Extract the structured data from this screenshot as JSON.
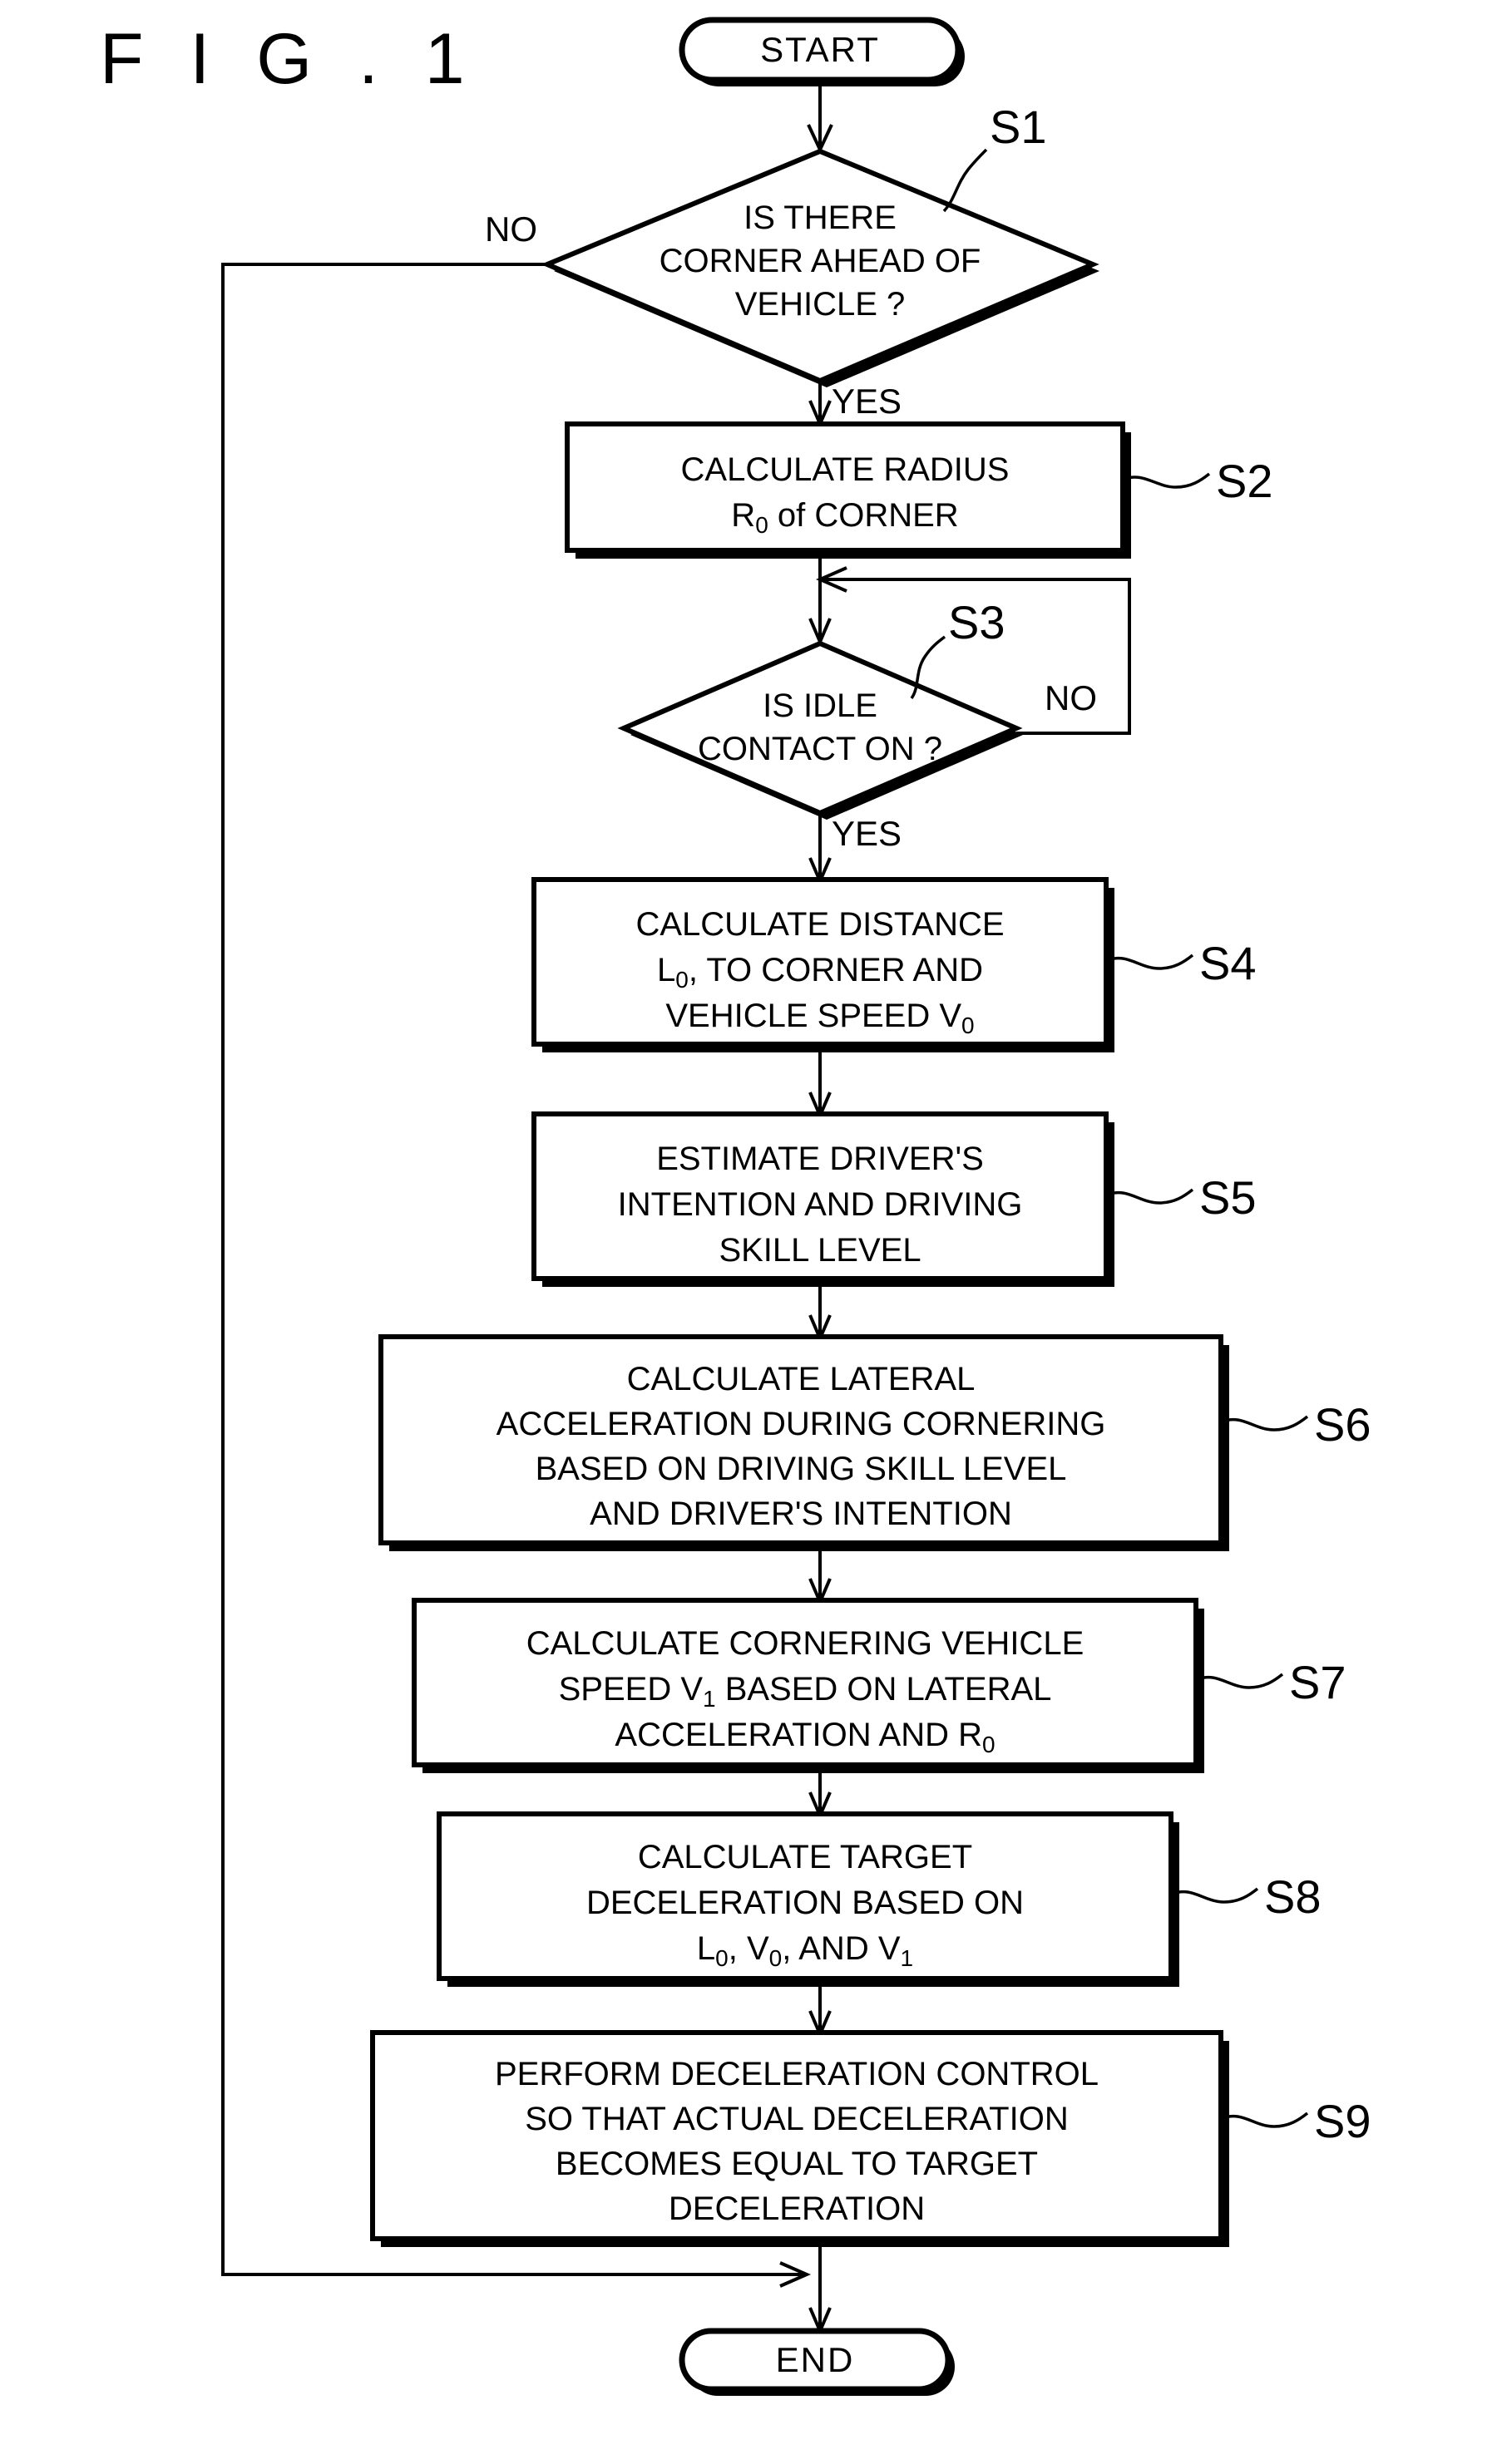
{
  "figure": {
    "title": "F I G . 1",
    "type": "flowchart"
  },
  "terminators": {
    "start": "START",
    "end": "END"
  },
  "branch_labels": {
    "s1_no": "NO",
    "s1_yes": "YES",
    "s3_no": "NO",
    "s3_yes": "YES"
  },
  "step_labels": {
    "s1": "S1",
    "s2": "S2",
    "s3": "S3",
    "s4": "S4",
    "s5": "S5",
    "s6": "S6",
    "s7": "S7",
    "s8": "S8",
    "s9": "S9"
  },
  "nodes": {
    "s1": {
      "id": "S1",
      "shape": "decision",
      "lines": [
        "IS THERE",
        "CORNER AHEAD OF",
        "VEHICLE ?"
      ]
    },
    "s2": {
      "id": "S2",
      "shape": "process",
      "lines": [
        "CALCULATE RADIUS",
        "R0 of CORNER"
      ]
    },
    "s3": {
      "id": "S3",
      "shape": "decision",
      "lines": [
        "IS IDLE",
        "CONTACT ON ?"
      ]
    },
    "s4": {
      "id": "S4",
      "shape": "process",
      "lines": [
        "CALCULATE DISTANCE",
        "L0, TO CORNER AND",
        "VEHICLE SPEED V0"
      ]
    },
    "s5": {
      "id": "S5",
      "shape": "process",
      "lines": [
        "ESTIMATE DRIVER'S",
        "INTENTION AND DRIVING",
        "SKILL LEVEL"
      ]
    },
    "s6": {
      "id": "S6",
      "shape": "process",
      "lines": [
        "CALCULATE LATERAL",
        "ACCELERATION DURING CORNERING",
        "BASED ON DRIVING SKILL LEVEL",
        "AND DRIVER'S INTENTION"
      ]
    },
    "s7": {
      "id": "S7",
      "shape": "process",
      "lines": [
        "CALCULATE CORNERING VEHICLE",
        "SPEED V1 BASED ON LATERAL",
        "ACCELERATION AND R0"
      ]
    },
    "s8": {
      "id": "S8",
      "shape": "process",
      "lines": [
        "CALCULATE TARGET",
        "DECELERATION BASED ON",
        "L0, V0, AND V1"
      ]
    },
    "s9": {
      "id": "S9",
      "shape": "process",
      "lines": [
        "PERFORM DECELERATION CONTROL",
        "SO THAT ACTUAL DECELERATION",
        "BECOMES EQUAL TO TARGET",
        "DECELERATION"
      ]
    }
  },
  "text_runs": {
    "s2_l2": [
      {
        "t": "R",
        "s": false
      },
      {
        "t": "0",
        "s": true
      },
      {
        "t": " of CORNER",
        "s": false
      }
    ],
    "s4_l2": [
      {
        "t": "L",
        "s": false
      },
      {
        "t": "0",
        "s": true
      },
      {
        "t": ", TO CORNER AND",
        "s": false
      }
    ],
    "s4_l3": [
      {
        "t": "VEHICLE SPEED V",
        "s": false
      },
      {
        "t": "0",
        "s": true
      }
    ],
    "s7_l2": [
      {
        "t": "SPEED V",
        "s": false
      },
      {
        "t": "1",
        "s": true
      },
      {
        "t": "  BASED ON LATERAL",
        "s": false
      }
    ],
    "s7_l3": [
      {
        "t": "ACCELERATION AND R",
        "s": false
      },
      {
        "t": "0",
        "s": true
      }
    ],
    "s8_l3": [
      {
        "t": "L",
        "s": false
      },
      {
        "t": "0",
        "s": true
      },
      {
        "t": ",  V",
        "s": false
      },
      {
        "t": "0",
        "s": true
      },
      {
        "t": ",  AND V",
        "s": false
      },
      {
        "t": "1",
        "s": true
      }
    ]
  },
  "colors": {
    "ink": "#000000",
    "paper": "#ffffff"
  }
}
